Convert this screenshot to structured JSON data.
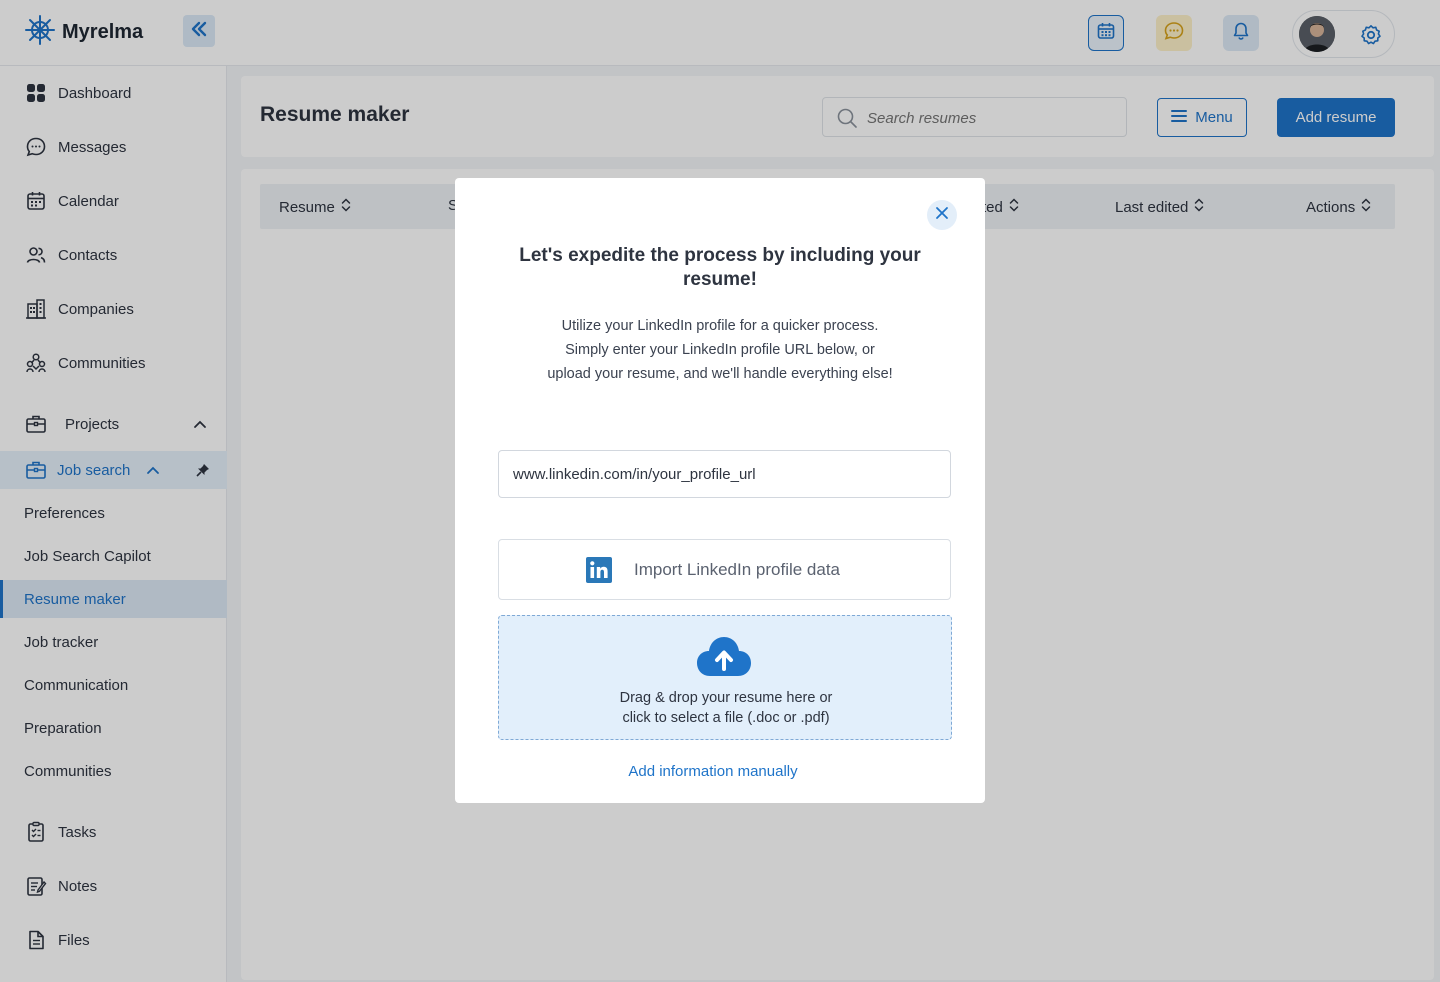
{
  "app": {
    "name": "Myrelma"
  },
  "topbar": {
    "icons": [
      "calendar-icon",
      "chat-icon",
      "bell-icon",
      "gear-icon"
    ]
  },
  "sidebar": {
    "items": [
      {
        "label": "Dashboard",
        "icon": "dashboard-icon"
      },
      {
        "label": "Messages",
        "icon": "chat-icon"
      },
      {
        "label": "Calendar",
        "icon": "calendar-icon"
      },
      {
        "label": "Contacts",
        "icon": "contacts-icon"
      },
      {
        "label": "Companies",
        "icon": "building-icon"
      },
      {
        "label": "Communities",
        "icon": "communities-icon"
      }
    ],
    "projects_label": "Projects",
    "job_search_label": "Job search",
    "job_search_items": [
      "Preferences",
      "Job Search Capilot",
      "Resume maker",
      "Job tracker",
      "Communication",
      "Preparation",
      "Communities"
    ],
    "bottom_items": [
      {
        "label": "Tasks",
        "icon": "tasks-icon"
      },
      {
        "label": "Notes",
        "icon": "notes-icon"
      },
      {
        "label": "Files",
        "icon": "file-icon"
      }
    ]
  },
  "header": {
    "title": "Resume maker",
    "search_placeholder": "Search resumes",
    "menu_label": "Menu",
    "add_label": "Add resume"
  },
  "table": {
    "columns": [
      "Resume",
      "S",
      "ted",
      "Last edited",
      "Actions"
    ]
  },
  "modal": {
    "title": "Let's expedite the process by including your resume!",
    "description": "Utilize your LinkedIn profile for a quicker process. Simply enter your LinkedIn profile URL below, or upload your resume, and we'll handle everything else!",
    "url_value": "www.linkedin.com/in/your_profile_url",
    "import_label": "Import LinkedIn profile data",
    "dropzone_line1": "Drag & drop your resume here or",
    "dropzone_line2": "click to select a file (.doc or .pdf)",
    "manual_link": "Add information manually"
  },
  "colors": {
    "accent": "#1f74c9",
    "overlay": "rgba(0,0,0,0.2)"
  }
}
